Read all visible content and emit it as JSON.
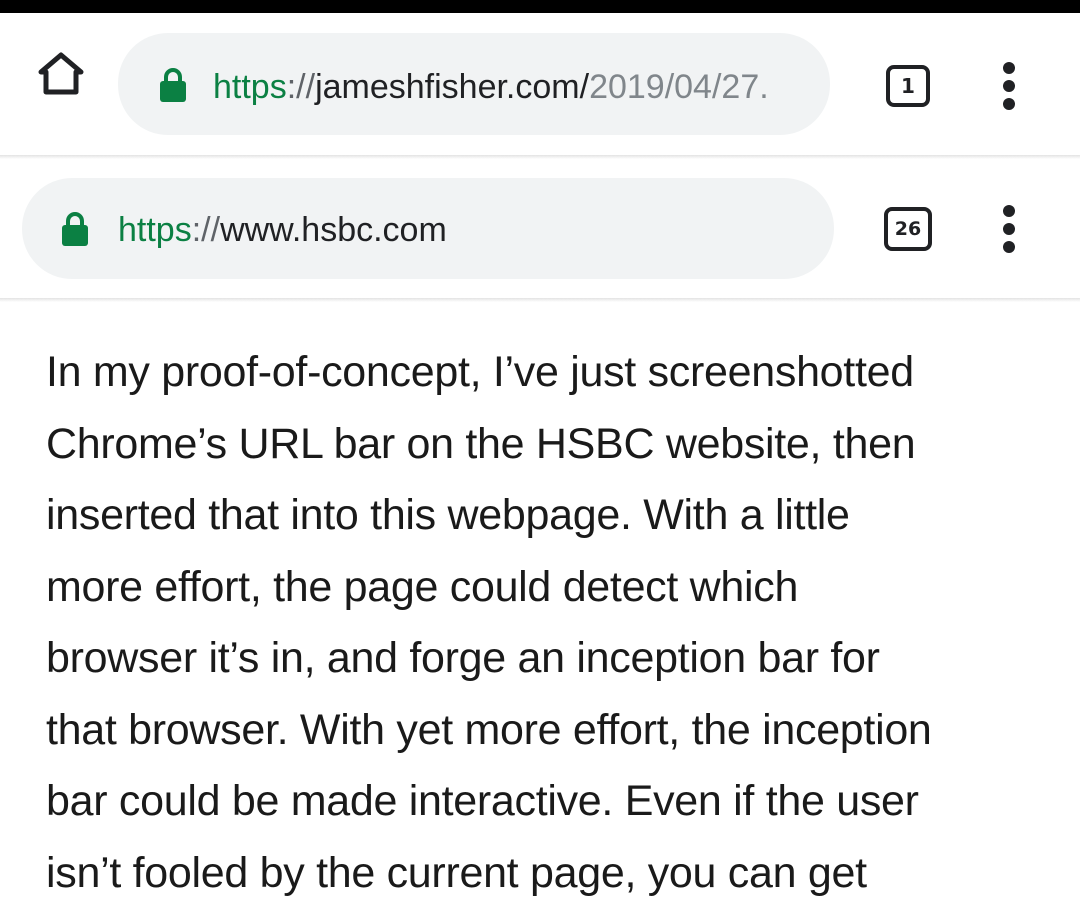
{
  "browser_toolbar": {
    "url_scheme": "https",
    "url_separator": "://",
    "url_host": "jameshfisher.com/",
    "url_path": "2019/04/27.",
    "tab_count": "1",
    "home_icon": "home-icon",
    "lock_icon": "lock-icon",
    "menu_icon": "more-vert-icon"
  },
  "inception_bar": {
    "url_scheme": "https",
    "url_separator": "://",
    "url_host": "www.hsbc.com",
    "tab_count": "26",
    "lock_icon": "lock-icon",
    "menu_icon": "more-vert-icon"
  },
  "article": {
    "lines": [
      "In my proof-of-concept, I’ve just screenshotted",
      "Chrome’s URL bar on the HSBC website, then",
      "inserted that into this webpage. With a little",
      "more effort, the page could detect which",
      "browser it’s in, and forge an inception bar for",
      "that browser. With yet more effort, the inception",
      "bar could be made interactive. Even if the user",
      "isn’t fooled by the current page, you can get"
    ]
  },
  "colors": {
    "scheme_green": "#0b8043",
    "urlbar_bg": "#f1f3f4",
    "host_text": "#202124",
    "path_text": "#80868b"
  }
}
